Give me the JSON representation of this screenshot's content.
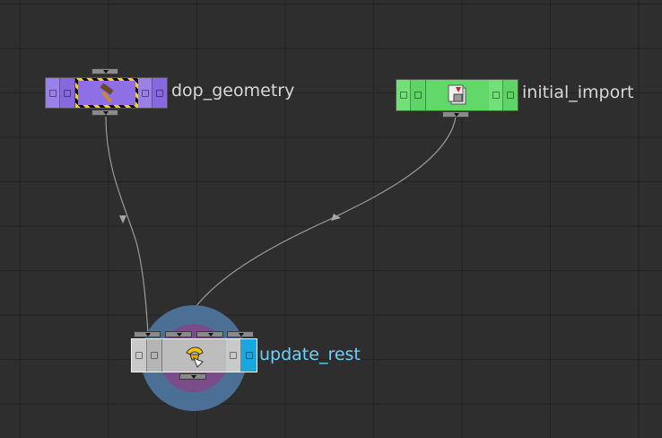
{
  "network": {
    "nodes": [
      {
        "id": "dop_geometry",
        "label": "dop_geometry",
        "color": "#8f6fe6",
        "icon": "hammer-icon"
      },
      {
        "id": "initial_import",
        "label": "initial_import",
        "color": "#63d86a",
        "icon": "import-file-icon"
      },
      {
        "id": "update_rest",
        "label": "update_rest",
        "color": "#bdbdbd",
        "icon": "wrangle-icon",
        "label_color": "#6fd0ff",
        "display_flag_color": "#19a7e0"
      }
    ],
    "wires": [
      {
        "from": "dop_geometry",
        "to": "update_rest"
      },
      {
        "from": "initial_import",
        "to": "update_rest"
      }
    ]
  },
  "colors": {
    "background": "#2e2e2e",
    "grid": "#232323",
    "label_default": "#d8d8d8",
    "wire": "#9a9a9a",
    "selection_ring_outer": "#4b6f95",
    "selection_ring_inner": "#7a4c89"
  }
}
